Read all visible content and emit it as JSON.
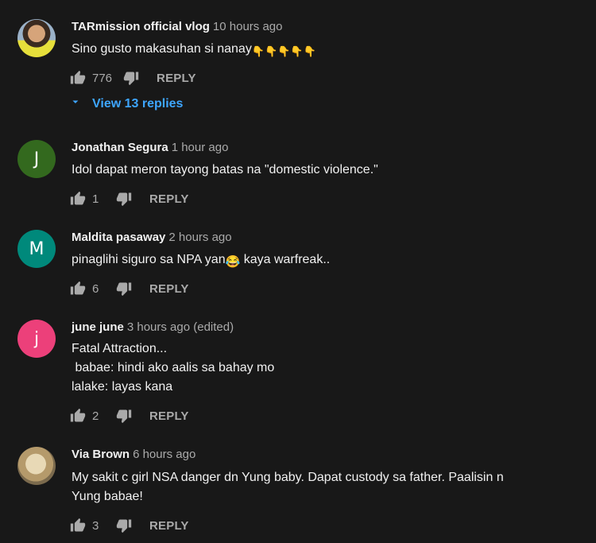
{
  "comments": [
    {
      "author": "TARmission official vlog",
      "time": "10 hours ago",
      "text": "Sino gusto makasuhan si nanay",
      "emoji": "👇👇👇👇👇",
      "likes": "776",
      "reply_label": "REPLY",
      "view_replies": "View 13 replies",
      "avatar_icon": "photo"
    },
    {
      "author": "Jonathan Segura",
      "time": "1 hour ago",
      "text": "Idol dapat meron tayong batas na \"domestic violence.\"",
      "likes": "1",
      "reply_label": "REPLY",
      "avatar_letter": "J",
      "avatar_color": "#33691e"
    },
    {
      "author": "Maldita pasaway",
      "time": "2 hours ago",
      "text_before": "pinaglihi siguro sa NPA yan",
      "emoji": "😂",
      "text_after": " kaya warfreak..",
      "likes": "6",
      "reply_label": "REPLY",
      "avatar_letter": "M",
      "avatar_color": "#00897b"
    },
    {
      "author": "june june",
      "time": "3 hours ago (edited)",
      "text": "Fatal Attraction...\n babae: hindi ako aalis sa bahay mo\nlalake: layas kana",
      "likes": "2",
      "reply_label": "REPLY",
      "avatar_letter": "j",
      "avatar_color": "#ec407a"
    },
    {
      "author": "Via Brown",
      "time": "6 hours ago",
      "text": "My sakit c girl NSA danger dn Yung baby. Dapat custody sa father. Paalisin n\nYung babae!",
      "likes": "3",
      "reply_label": "REPLY",
      "avatar_icon": "photo"
    }
  ],
  "icons": {
    "like": "thumb-up-icon",
    "dislike": "thumb-down-icon",
    "expand": "chevron-down-icon"
  },
  "colors": {
    "background": "#181818",
    "link": "#3ea6ff",
    "secondary_text": "#aaaaaa"
  }
}
